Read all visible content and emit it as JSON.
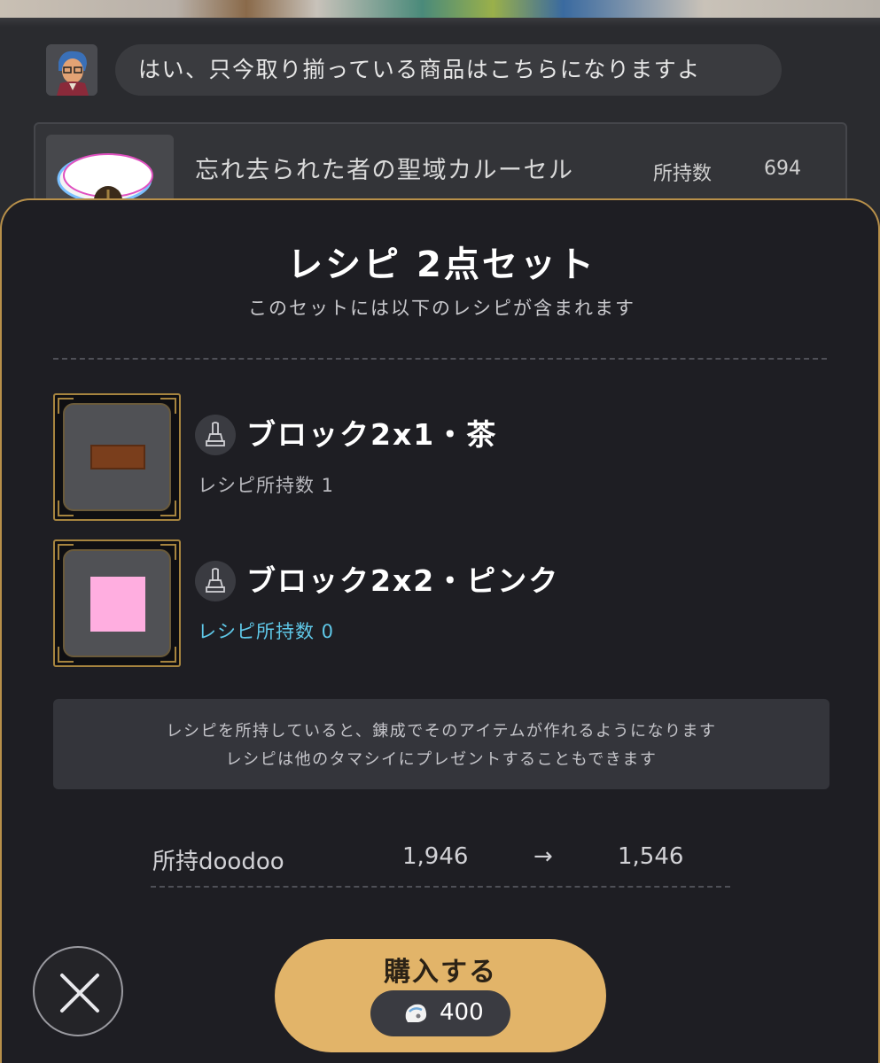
{
  "npc": {
    "message": "はい、只今取り揃っている商品はこちらになりますよ"
  },
  "shop_item": {
    "name": "忘れ去られた者の聖域カルーセル",
    "owned_label": "所持数",
    "owned_value": "694"
  },
  "modal": {
    "title": "レシピ 2点セット",
    "subtitle": "このセットには以下のレシピが含まれます",
    "recipes": [
      {
        "name": "ブロック2x1・茶",
        "count_label": "レシピ所持数 1",
        "swatch_color": "#7a3e1c",
        "icon": "statue-icon"
      },
      {
        "name": "ブロック2x2・ピンク",
        "count_label": "レシピ所持数 0",
        "swatch_color": "#ffaee0",
        "icon": "statue-icon"
      }
    ],
    "info_lines": [
      "レシピを所持していると、錬成でそのアイテムが作れるようになります",
      "レシピは他のタマシイにプレゼントすることもできます"
    ],
    "currency": {
      "label": "所持doodoo",
      "from": "1,946",
      "arrow": "→",
      "to": "1,546"
    },
    "buy_button": {
      "label": "購入する",
      "price": "400",
      "price_icon": "doodoo-currency-icon"
    },
    "close_icon": "close-icon"
  },
  "colors": {
    "accent_gold": "#e2b469",
    "frame_gold": "#a6843f",
    "count_zero_blue": "#5fc8e8",
    "sheet_bg": "#1e1e23"
  }
}
